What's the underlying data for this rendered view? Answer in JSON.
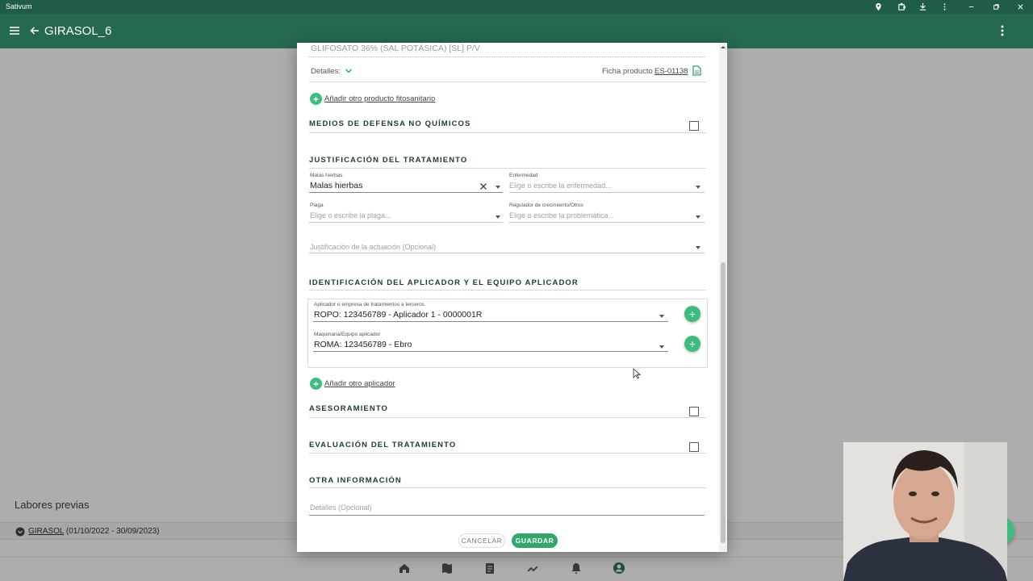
{
  "window": {
    "title": "Sativum"
  },
  "appbar": {
    "title": "GIRASOL_6"
  },
  "background": {
    "labores_title": "Labores previas",
    "labores_link": "GIRASOL",
    "labores_dates": " (01/10/2022 - 30/09/2023)"
  },
  "modal": {
    "product_name": "GLIFOSATO 36% (SAL POTÁSICA)  [SL] P/V",
    "details_label": "Detalles:",
    "ficha_label": "Ficha producto",
    "ficha_code": "ES-01138",
    "add_product": "Añadir otro producto fitosanitario",
    "section_non_chemical": "MEDIOS DE DEFENSA NO QUÍMICOS",
    "section_justification": "JUSTIFICACIÓN DEL TRATAMIENTO",
    "malas_hierbas": {
      "label": "Malas hierbas",
      "value": "Malas hierbas"
    },
    "enfermedad": {
      "label": "Enfermedad",
      "placeholder": "Elige o escribe la enfermedad..."
    },
    "plaga": {
      "label": "Plaga",
      "placeholder": "Elige o escribe la plaga..."
    },
    "regulador": {
      "label": "Regulador de crecimiento/Otros",
      "placeholder": "Elige o escribe la problemática..."
    },
    "justificacion_actuacion": {
      "placeholder": "Justificación de la actuación (Opcional)"
    },
    "section_applicator": "IDENTIFICACIÓN DEL APLICADOR Y EL EQUIPO APLICADOR",
    "aplicador": {
      "label": "Aplicador o empresa de tratamientos a terceros",
      "value": "ROPO: 123456789 - Aplicador 1 - 0000001R"
    },
    "maquinaria": {
      "label": "Maquinaria/Equipo aplicador",
      "value": "ROMA: 123456789 - Ebro"
    },
    "add_applicator": "Añadir otro aplicador",
    "section_asesoramiento": "ASESORAMIENTO",
    "section_evaluacion": "EVALUACIÓN DEL TRATAMIENTO",
    "section_otra": "OTRA INFORMACIÓN",
    "detalles_placeholder": "Detalles (Opcional)",
    "cancel_label": "CANCELAR",
    "save_label": "GUARDAR",
    "checkboxes": {
      "non_chemical": false,
      "asesoramiento": false,
      "evaluacion": false
    }
  },
  "colors": {
    "appbar": "#25694f",
    "titlebar": "#1f5c4a",
    "accent": "#3dbd7d",
    "save_button": "#2fa86a"
  }
}
